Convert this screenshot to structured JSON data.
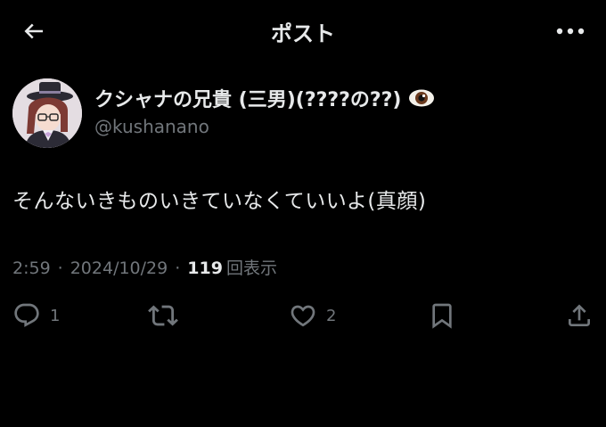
{
  "header": {
    "title": "ポスト",
    "back_icon": "arrow-left-icon",
    "more_icon": "more-horizontal-icon"
  },
  "author": {
    "display_name": "クシャナの兄貴 (三男)(????の??)",
    "handle": "@kushanano",
    "name_emoji": "eye-icon"
  },
  "tweet": {
    "text": "そんないきものいきていなくていいよ(真顔)"
  },
  "meta": {
    "time": "2:59",
    "separator": "·",
    "date": "2024/10/29",
    "views_count": "119",
    "views_label": "回表示"
  },
  "actions": {
    "reply_count": "1",
    "like_count": "2"
  },
  "colors": {
    "background": "#000000",
    "text_primary": "#e7e9ea",
    "text_secondary": "#71767b"
  }
}
